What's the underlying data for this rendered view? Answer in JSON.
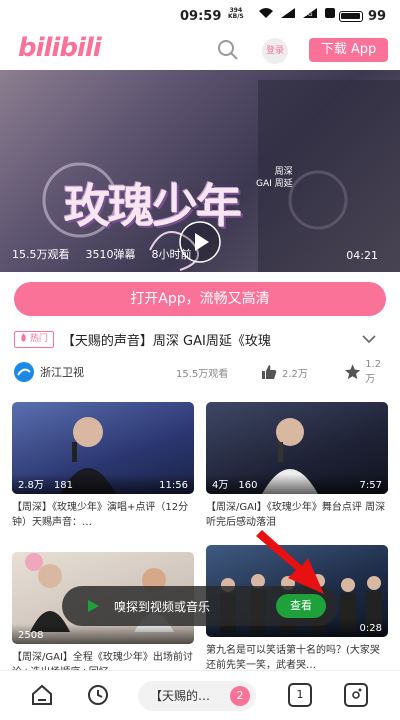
{
  "status_bar": {
    "time": "09:59",
    "speed_value": "394",
    "speed_unit": "KB/S",
    "battery_level": "99"
  },
  "header": {
    "logo": "bilibili",
    "login_label": "登录",
    "download_label": "下载 App"
  },
  "video": {
    "title_art": "玫瑰少年",
    "credit": "周深\nGAI 周延",
    "views": "15.5万观看",
    "danmaku": "3510弹幕",
    "time_ago": "8小时前",
    "duration": "04:21"
  },
  "open_app_label": "打开App，流畅又高清",
  "info": {
    "hot_badge": "热门",
    "title": "【天赐的声音】周深 GAI周延《玫瑰",
    "channel": "浙江卫视",
    "views": "15.5万观看",
    "likes": "2.2万",
    "favorites": "1.2万"
  },
  "cards": [
    {
      "plays": "2.8万",
      "danmaku": "181",
      "duration": "11:56",
      "title": "【周深】《玫瑰少年》演唱+点评（12分钟）天赐声音：…",
      "thumb_color": "#3a4a7a"
    },
    {
      "plays": "4万",
      "danmaku": "160",
      "duration": "7:57",
      "title": "【周深/GAI】《玫瑰少年》舞台点评 周深听完后感动落泪",
      "thumb_color": "#2d3550"
    },
    {
      "plays": "2508",
      "danmaku": "",
      "duration": "",
      "title": "【周深/GAI】全程《玫瑰少年》出场前讨论+选出场顺序+回忆…",
      "thumb_color": "#c8c0b8"
    },
    {
      "plays": "",
      "danmaku": "",
      "duration": "0:28",
      "title": "第九名是可以笑话第十名的吗？(大家哭还前先笑一笑，武者哭…",
      "thumb_color": "#2a3a5a"
    }
  ],
  "toast": {
    "text": "嗅探到视频或音乐",
    "button": "查看"
  },
  "navbar": {
    "pill_text": "【天赐的…",
    "pill_count": "2",
    "tab_count": "1"
  },
  "colors": {
    "brand_pink": "#fb7299",
    "toast_green": "#1ea03a",
    "arrow_red": "#e81010"
  }
}
